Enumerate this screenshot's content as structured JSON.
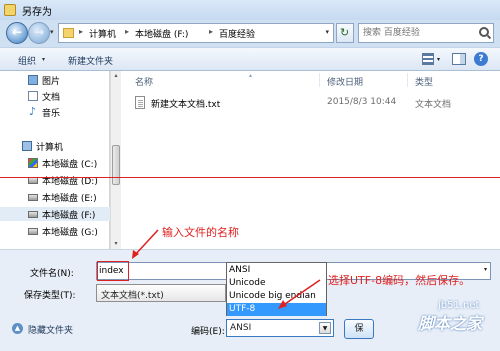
{
  "window": {
    "title": "另存为"
  },
  "address": {
    "crumbs": [
      "计算机",
      "本地磁盘 (F:)",
      "百度经验"
    ],
    "separator": "▸"
  },
  "search": {
    "placeholder": "搜索 百度经验"
  },
  "toolbar": {
    "organize": "组织",
    "new_folder": "新建文件夹",
    "help": "?"
  },
  "sidebar": {
    "items": [
      {
        "label": "图片",
        "icon": "pictures-icon"
      },
      {
        "label": "文档",
        "icon": "documents-icon"
      },
      {
        "label": "音乐",
        "icon": "music-icon"
      },
      {
        "label": "计算机",
        "icon": "computer-icon"
      },
      {
        "label": "本地磁盘 (C:)",
        "icon": "drive-icon"
      },
      {
        "label": "本地磁盘 (D:)",
        "icon": "drive-icon"
      },
      {
        "label": "本地磁盘 (E:)",
        "icon": "drive-icon"
      },
      {
        "label": "本地磁盘 (F:)",
        "icon": "drive-icon"
      },
      {
        "label": "本地磁盘 (G:)",
        "icon": "drive-icon"
      }
    ]
  },
  "filelist": {
    "columns": [
      "名称",
      "修改日期",
      "类型"
    ],
    "files": [
      {
        "name": "新建文本文档.txt",
        "modified": "2015/8/3 10:44",
        "type": "文本文档"
      }
    ]
  },
  "form": {
    "filename_label": "文件名(N):",
    "filename_value": "index",
    "filetype_label": "保存类型(T):",
    "filetype_value": "文本文档(*.txt)",
    "encoding_label": "编码(E):",
    "encoding_value": "ANSI",
    "save_label": "保",
    "hide_folders_label": "隐藏文件夹"
  },
  "encoding_options": [
    "ANSI",
    "Unicode",
    "Unicode big endian",
    "UTF-8"
  ],
  "encoding_selected": "UTF-8",
  "annotations": {
    "filename_hint": "输入文件的名称",
    "encoding_hint": "选择UTF-8编码，然后保存。"
  },
  "watermark": {
    "url": "jb51.net",
    "brand": "脚本之家"
  },
  "colors": {
    "annotation": "#e02020",
    "selection": "#3399ff"
  }
}
